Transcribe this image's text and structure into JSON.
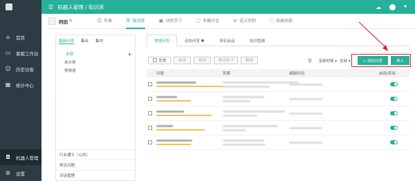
{
  "sidebar": {
    "items": [
      {
        "label": "首页",
        "icon": "home-icon"
      },
      {
        "label": "客服工作台",
        "icon": "monitor-icon"
      },
      {
        "label": "历史访客",
        "icon": "users-icon"
      },
      {
        "label": "统计中心",
        "icon": "chart-icon"
      }
    ],
    "bottom": [
      {
        "label": "机器人管理",
        "icon": "robot-icon"
      },
      {
        "label": "设置",
        "icon": "gear-icon"
      }
    ]
  },
  "topbar": {
    "breadcrumb": "机器人管理 / 知识库"
  },
  "robot": {
    "name": "阿田",
    "tabs": [
      {
        "label": "形象",
        "icon": "robot-face-icon"
      },
      {
        "label": "知识库",
        "icon": "list-icon"
      },
      {
        "label": "训练学习",
        "icon": "training-icon"
      },
      {
        "label": "多模对话",
        "icon": "dialog-icon"
      },
      {
        "label": "语义控制",
        "icon": "sliders-icon"
      },
      {
        "label": "拓展技能",
        "icon": "bulb-icon"
      }
    ]
  },
  "category": {
    "tabs": [
      "基础分类",
      "集合",
      "集中"
    ],
    "all_label": "全部",
    "add": "+",
    "items": [
      "未分类",
      "常用语"
    ],
    "bottom_items": [
      "行业通义（公共）",
      "常见问题",
      "对话管理"
    ]
  },
  "subtabs": [
    "常规问答",
    "动态问答",
    "多轮会话",
    "知识图谱"
  ],
  "toolbar": {
    "select_all": "全选",
    "buttons": [
      "启用",
      "禁用",
      "移动到",
      "删除"
    ],
    "dropdown1": "全部时效",
    "dropdown2": "全部",
    "add_label": "+ 添加问答",
    "import_label": "导入"
  },
  "table": {
    "headers": [
      "问题",
      "答案",
      "编辑时间",
      "启用/禁用"
    ],
    "row_count": 5
  },
  "colors": {
    "accent": "#27b09a",
    "sidebar": "#2d3b45",
    "highlight": "#d82424"
  }
}
